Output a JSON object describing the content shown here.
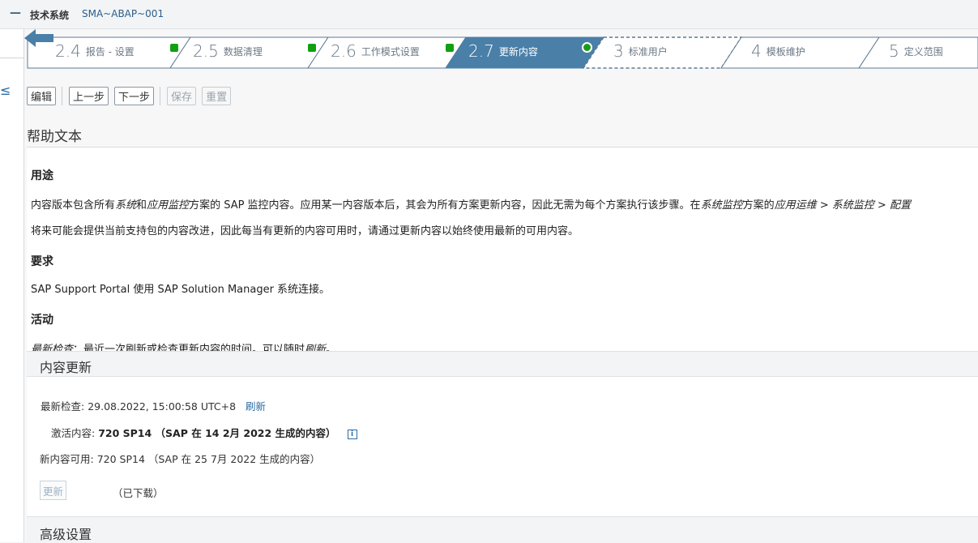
{
  "header": {
    "collapse_symbol": "—",
    "tech_system_label": "技术系统",
    "tech_system_value": "SMA~ABAP~001"
  },
  "roadmap": {
    "steps": [
      {
        "num": "2.4",
        "label": "报告 - 设置",
        "status": "complete"
      },
      {
        "num": "2.5",
        "label": "数据清理",
        "status": "complete"
      },
      {
        "num": "2.6",
        "label": "工作模式设置",
        "status": "complete"
      },
      {
        "num": "2.7",
        "label": "更新内容",
        "status": "active"
      },
      {
        "num": "3",
        "label": "标准用户",
        "status": "pending"
      },
      {
        "num": "4",
        "label": "模板维护",
        "status": "pending"
      },
      {
        "num": "5",
        "label": "定义范围",
        "status": "pending"
      }
    ],
    "active_color": "#4a7fa8",
    "complete_color": "#11a011"
  },
  "toolbar": {
    "edit": "编辑",
    "prev": "上一步",
    "next": "下一步",
    "save": "保存",
    "reset": "重置"
  },
  "help": {
    "title": "帮助文本",
    "purpose_heading": "用途",
    "purpose_p1_a": "内容版本包含所有",
    "purpose_p1_b": "系统",
    "purpose_p1_c": "和",
    "purpose_p1_d": "应用监控",
    "purpose_p1_e": "方案的 SAP 监控内容。应用某一内容版本后，其会为所有方案更新内容，因此无需为每个方案执行该步骤。在",
    "purpose_p1_f": "系统监控",
    "purpose_p1_g": "方案的",
    "purpose_p1_h": "应用运维",
    "purpose_p1_i": " > ",
    "purpose_p1_j": "系统监控",
    "purpose_p1_k": " > ",
    "purpose_p1_l": "配置",
    "purpose_p2": "将来可能会提供当前支持包的内容改进，因此每当有更新的内容可用时，请通过更新内容以始终使用最新的可用内容。",
    "req_heading": "要求",
    "req_p": "SAP Support Portal 使用 SAP Solution Manager 系统连接。",
    "act_heading": "活动",
    "act_p_a": "最新检查",
    "act_p_b": "：最近一次刷新或检查更新内容的时间。可以随时",
    "act_p_c": "刷新",
    "act_p_d": "。"
  },
  "content_update": {
    "title": "内容更新",
    "last_check_label": "最新检查:",
    "last_check_value": "29.08.2022, 15:00:58 UTC+8",
    "refresh_link": "刷新",
    "active_label": "激活内容:",
    "active_value": "720 SP14 （SAP 在 14 2月 2022 生成的内容）",
    "new_label": "新内容可用:",
    "new_value": "720 SP14 （SAP 在 25 7月 2022 生成的内容）",
    "update_button": "更新",
    "downloaded": "（已下载）",
    "info_icon_glyph": "i"
  },
  "advanced": {
    "title": "高级设置"
  },
  "sidebar": {
    "glyph": "≤"
  }
}
